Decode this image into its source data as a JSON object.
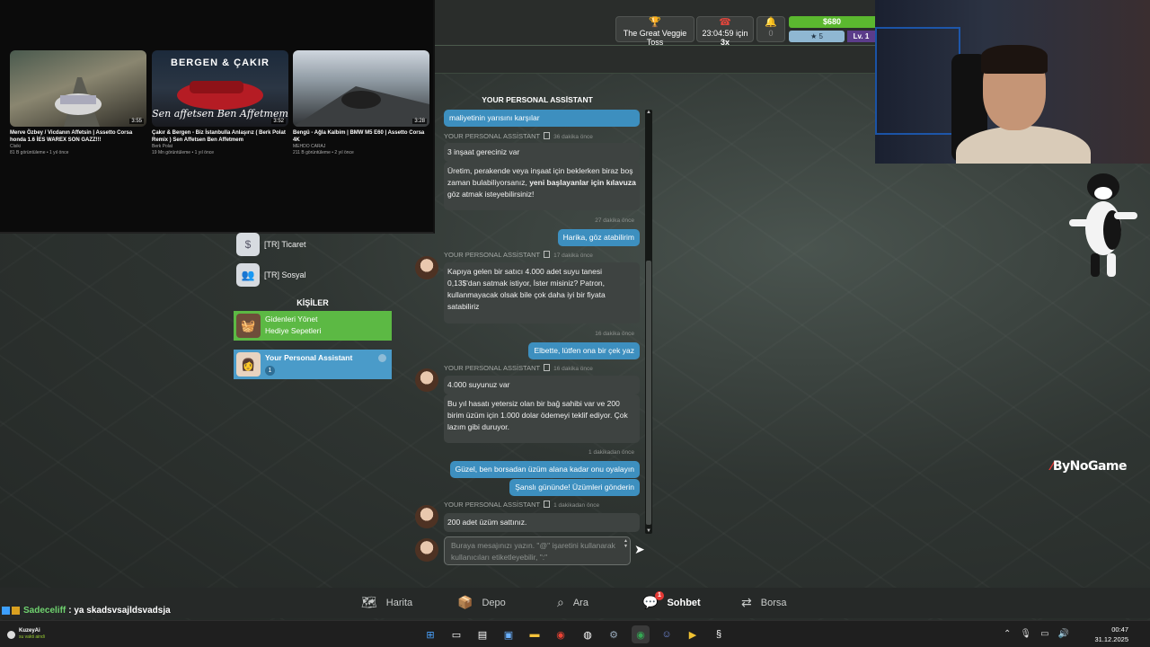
{
  "topbar": {
    "event_label": "The Great Veggie Toss",
    "timer_text": "23:04:59 için",
    "timer_multiplier": "3x",
    "bell_count": "0",
    "money": "$680",
    "stars": "5",
    "level": "Lv. 1"
  },
  "videos": [
    {
      "title": "Merve Özbey / Vicdanın Affetsin | Assetto Corsa honda 1.6 İES WAREX SON GAZZ!!!",
      "channel": "Clsiki",
      "meta": "81 B görüntüleme • 1 yıl önce",
      "duration": "3:55",
      "brand": "",
      "script": ""
    },
    {
      "title": "Çakır & Bergen - Biz İstanbulla Anlaşırız ( Berk Polat Remix ) Sen Affetsen Ben Affetmem",
      "channel": "Berk Polat",
      "meta": "19 Mn görüntüleme • 1 yıl önce",
      "duration": "3:52",
      "brand": "BERGEN & ÇAKIR",
      "script": "Sen affetsen Ben Affetmem"
    },
    {
      "title": "Bengü - Ağla Kalbim | BMW M5 E60 | Assetto Corsa 4K",
      "channel": "MEHDO CARAJ",
      "meta": "211 B görüntüleme • 2 yıl önce",
      "duration": "3:28",
      "brand": "",
      "script": ""
    }
  ],
  "left_panel": {
    "categories": [
      {
        "label": "[TR] Ticaret",
        "icon": "dollar-tag-icon"
      },
      {
        "label": "[TR] Sosyal",
        "icon": "people-icon"
      }
    ],
    "contacts_header": "KİŞİLER",
    "contacts": [
      {
        "line1": "Gidenleri Yönet",
        "line2": "Hediye Sepetleri",
        "badge": ""
      },
      {
        "line1": "Your Personal Assistant",
        "line2": "",
        "badge": "1"
      }
    ]
  },
  "chat": {
    "title": "YOUR PERSONAL ASSİSTANT",
    "top_partial": "maliyetinin yarısını karşılar",
    "msg1_sender": "YOUR PERSONAL ASSİSTANT",
    "msg1_time": "36 dakika önce",
    "msg1_a": "3 inşaat gereciniz var",
    "msg1_b_pre": "Üretim, perakende veya inşaat için beklerken biraz boş zaman bulabiliyorsanız, ",
    "msg1_b_bold1": "yeni başlayanlar için",
    "msg1_b_bold2": "kılavuza",
    "msg1_b_post": " göz atmak isteyebilirsiniz!",
    "stamp1": "27 dakika önce",
    "reply1": "Harika, göz atabilirim",
    "msg2_sender": "YOUR PERSONAL ASSİSTANT",
    "msg2_time": "17 dakika önce",
    "msg2": "Kapıya gelen bir satıcı 4.000 adet suyu tanesi 0,13$'dan satmak istiyor, İster misiniz? Patron, kullanmayacak olsak bile çok daha iyi bir fiyata satabiliriz",
    "stamp2": "16 dakika önce",
    "reply2": "Elbette, lütfen ona bir çek yaz",
    "msg3_sender": "YOUR PERSONAL ASSİSTANT",
    "msg3_time": "16 dakika önce",
    "msg3_a": "4.000 suyunuz var",
    "msg3_b": "Bu yıl hasatı yetersiz olan bir bağ sahibi var ve 200 birim üzüm için 1.000 dolar ödemeyi teklif ediyor. Çok lazım gibi duruyor.",
    "stamp3": "1 dakikadan önce",
    "reply3": "Güzel, ben borsadan üzüm alana kadar onu oyalayın",
    "reply4": "Şanslı gününde! Üzümleri gönderin",
    "msg4_sender": "YOUR PERSONAL ASSİSTANT",
    "msg4_time": "1 dakikadan önce",
    "msg4": "200 adet üzüm sattınız.",
    "input_placeholder": "Buraya mesajınızı yazın. \"@\" işaretini kullanarak kullanıcıları etiketleyebilir, \":\""
  },
  "bottom_nav": {
    "items": [
      {
        "label": "Harita",
        "icon": "map-icon"
      },
      {
        "label": "Depo",
        "icon": "box-icon"
      },
      {
        "label": "Ara",
        "icon": "search-icon"
      },
      {
        "label": "Sohbet",
        "icon": "chat-icon",
        "badge": "1"
      },
      {
        "label": "Borsa",
        "icon": "exchange-icon"
      }
    ]
  },
  "stream_chat": {
    "user": "Sadeceliff",
    "message": ": ya skadsvsajldsvadsja"
  },
  "watermark": {
    "text": "ByNoGame"
  },
  "taskbar": {
    "user_name": "KuzeyAi",
    "user_status": "su vakti aindi",
    "time": "00:47",
    "date": "31.12.2025"
  },
  "colors": {
    "accent_blue": "#3d8fbf",
    "money_green": "#5bb82f",
    "contact_green": "#5cb944",
    "level_purple": "#5b3c8a",
    "badge_red": "#e53935"
  }
}
